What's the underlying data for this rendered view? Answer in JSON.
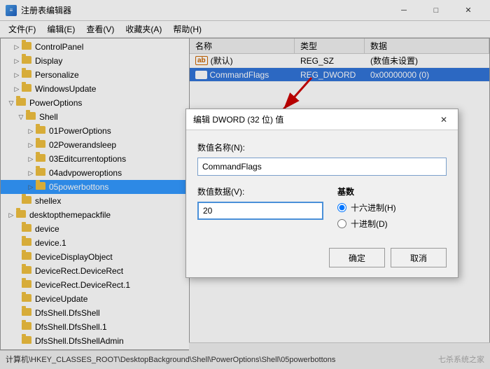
{
  "window": {
    "title": "注册表编辑器",
    "icon_label": "reg"
  },
  "menu": {
    "items": [
      "文件(F)",
      "编辑(E)",
      "查看(V)",
      "收藏夹(A)",
      "帮助(H)"
    ]
  },
  "tree": {
    "items": [
      {
        "indent": 1,
        "expand": "▷",
        "label": "ControlPanel",
        "open": false
      },
      {
        "indent": 1,
        "expand": "▷",
        "label": "Display",
        "open": false
      },
      {
        "indent": 1,
        "expand": "▷",
        "label": "Personalize",
        "open": false
      },
      {
        "indent": 1,
        "expand": "▷",
        "label": "WindowsUpdate",
        "open": false
      },
      {
        "indent": 1,
        "expand": "▽",
        "label": "PowerOptions",
        "open": true
      },
      {
        "indent": 2,
        "expand": "▽",
        "label": "Shell",
        "open": true,
        "selected": false
      },
      {
        "indent": 3,
        "expand": "▷",
        "label": "01PowerOptions",
        "open": false
      },
      {
        "indent": 3,
        "expand": "▷",
        "label": "02Powerandsleep",
        "open": false
      },
      {
        "indent": 3,
        "expand": "▷",
        "label": "03Editcurrentoptions",
        "open": false
      },
      {
        "indent": 3,
        "expand": "▷",
        "label": "04advpoweroptions",
        "open": false
      },
      {
        "indent": 3,
        "expand": "▷",
        "label": "05powerbottons",
        "open": false,
        "selected": true
      },
      {
        "indent": 1,
        "expand": "",
        "label": "shellex",
        "open": false
      },
      {
        "indent": 1,
        "expand": "▷",
        "label": "desktopthemepackfile",
        "open": false
      },
      {
        "indent": 1,
        "expand": "",
        "label": "device",
        "open": false
      },
      {
        "indent": 1,
        "expand": "",
        "label": "device.1",
        "open": false
      },
      {
        "indent": 1,
        "expand": "",
        "label": "DeviceDisplayObject",
        "open": false
      },
      {
        "indent": 1,
        "expand": "",
        "label": "DeviceRect.DeviceRect",
        "open": false
      },
      {
        "indent": 1,
        "expand": "",
        "label": "DeviceRect.DeviceRect.1",
        "open": false
      },
      {
        "indent": 1,
        "expand": "",
        "label": "DeviceUpdate",
        "open": false
      },
      {
        "indent": 1,
        "expand": "",
        "label": "DfsShell.DfsShell",
        "open": false
      },
      {
        "indent": 1,
        "expand": "",
        "label": "DfsShell.DfsShell.1",
        "open": false
      },
      {
        "indent": 1,
        "expand": "",
        "label": "DfsShell.DfsShellAdmin",
        "open": false
      }
    ]
  },
  "registry": {
    "columns": [
      "名称",
      "类型",
      "数据"
    ],
    "rows": [
      {
        "icon": "ab",
        "name": "(默认)",
        "type": "REG_SZ",
        "data": "(数值未设置)",
        "selected": false
      },
      {
        "icon": "dw",
        "name": "CommandFlags",
        "type": "REG_DWORD",
        "data": "0x00000000 (0)",
        "selected": true
      }
    ]
  },
  "dialog": {
    "title": "编辑 DWORD (32 位) 值",
    "name_label": "数值名称(N):",
    "name_value": "CommandFlags",
    "data_label": "数值数据(V):",
    "data_value": "20",
    "radix_title": "基数",
    "radix_options": [
      {
        "label": "● 十六进制(H)",
        "value": "hex",
        "checked": true
      },
      {
        "label": "○ 十进制(D)",
        "value": "dec",
        "checked": false
      }
    ],
    "ok_label": "确定",
    "cancel_label": "取消"
  },
  "status_bar": {
    "text": "计算机\\HKEY_CLASSES_ROOT\\DesktopBackground\\Shell\\PowerOptions\\Shell\\05powerbottons"
  },
  "watermark": "七杀系统之家"
}
